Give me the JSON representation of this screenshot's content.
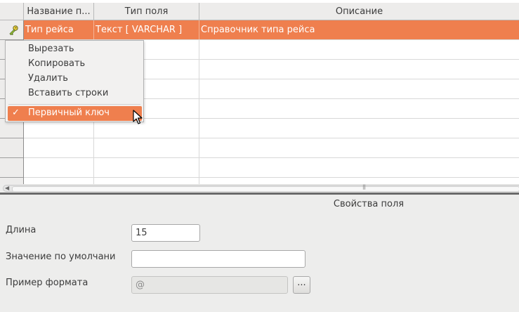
{
  "table": {
    "columns": [
      "Название п...",
      "Тип поля",
      "Описание"
    ],
    "selected_row": {
      "name": "Тип рейса",
      "type": "Текст [ VARCHAR ]",
      "description": "Справочник типа рейса"
    }
  },
  "context_menu": {
    "items": [
      "Вырезать",
      "Копировать",
      "Удалить",
      "Вставить строки"
    ],
    "checked_item": "Первичный ключ",
    "checked": true
  },
  "properties": {
    "title": "Свойства поля",
    "length_label": "Длина",
    "length_value": "15",
    "default_label": "Значение по умолчани",
    "default_value": "",
    "format_label": "Пример формата",
    "format_value": "@",
    "format_button": "..."
  },
  "icons": {
    "primary_key": "key-icon",
    "check": "check-icon",
    "cursor": "mouse-pointer-icon"
  },
  "colors": {
    "selection": "#ef7f4e",
    "header_bg": "#edeceb"
  }
}
